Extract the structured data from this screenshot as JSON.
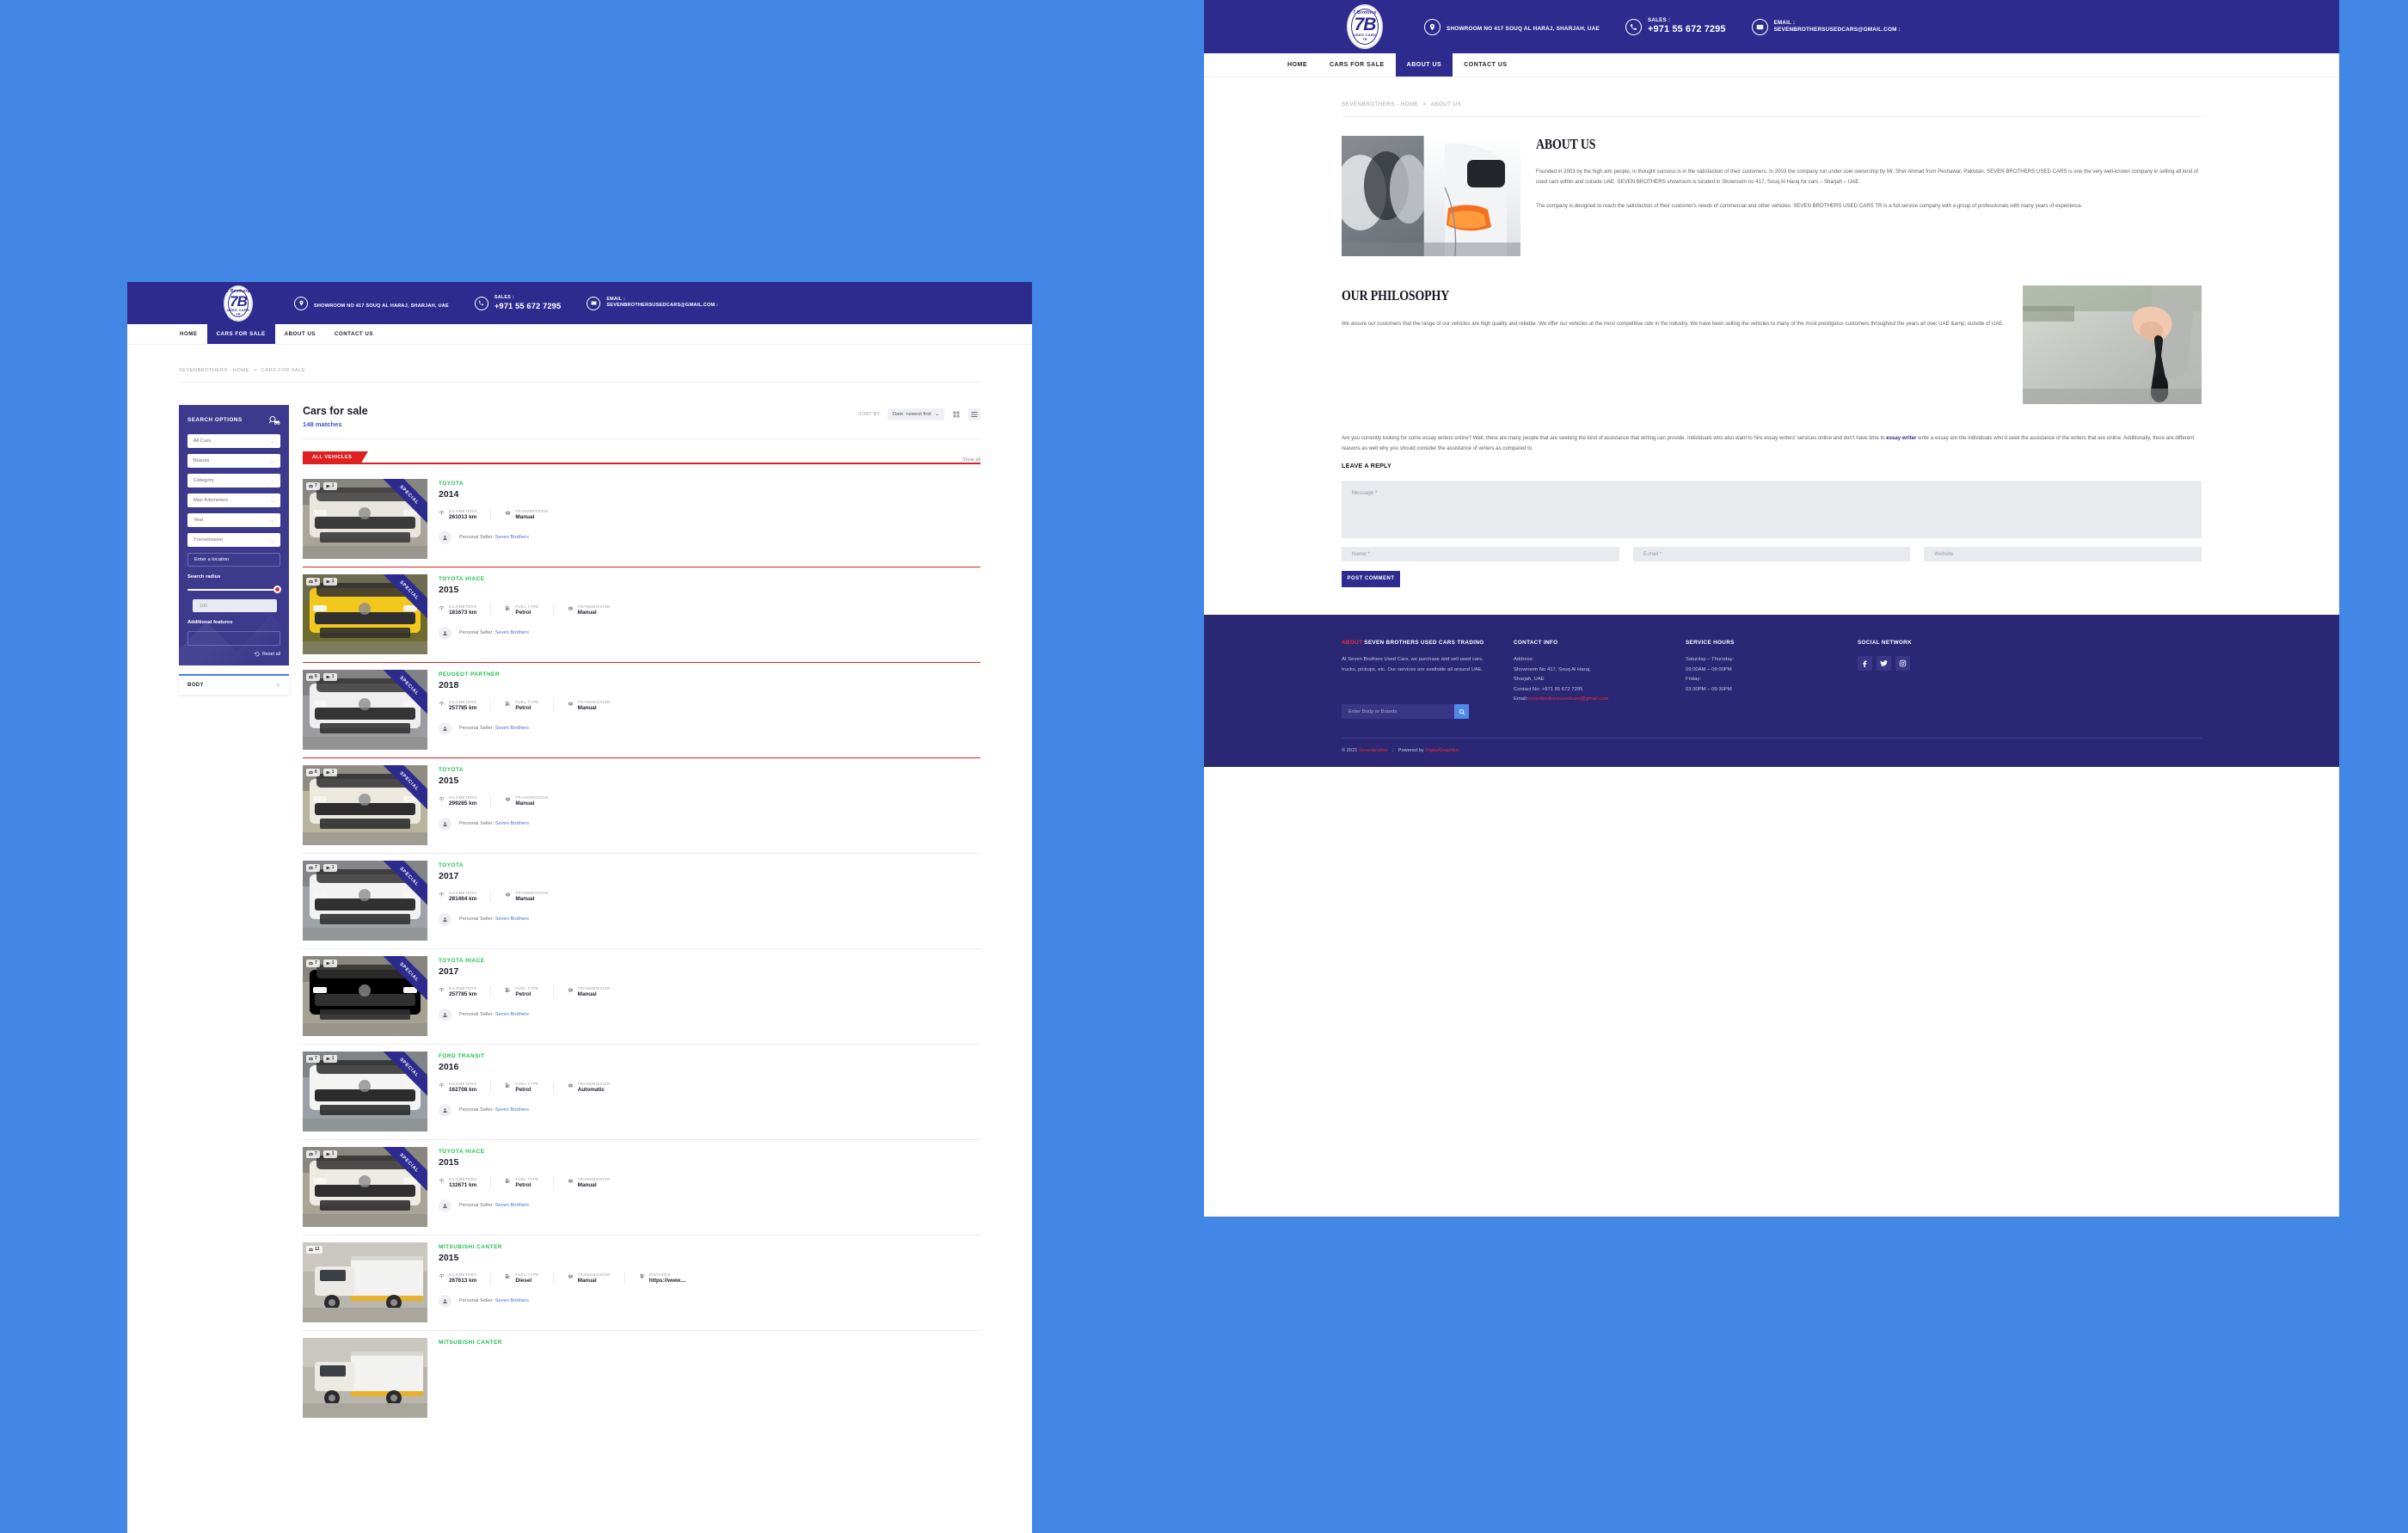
{
  "brand": {
    "logo_top": "7 Brothers",
    "logo_main": "7B",
    "logo_sub": "USED CARS",
    "logo_sub2": "TR"
  },
  "topbar": {
    "location_icon": "map-pin-icon",
    "location_text": "SHOWROOM NO 417 SOUQ AL HARAJ, SHARJAH, UAE",
    "sales_icon": "phone-icon",
    "sales_label": "SALES :",
    "sales_value": "+971 55 672 7295",
    "email_icon": "envelope-icon",
    "email_label": "EMAIL :",
    "email_value": "SEVENBROTHERSUSEDCARS@GMAIL.COM :"
  },
  "nav": {
    "items": [
      {
        "label": "HOME",
        "active_left": false,
        "active_right": false
      },
      {
        "label": "CARS FOR SALE",
        "active_left": true,
        "active_right": false
      },
      {
        "label": "ABOUT US",
        "active_left": false,
        "active_right": true
      },
      {
        "label": "CONTACT US",
        "active_left": false,
        "active_right": false
      }
    ]
  },
  "left_window": {
    "breadcrumb": {
      "root": "SEVENBROTHERS - HOME",
      "sep": ">",
      "current": "CARS FOR SALE"
    },
    "sidebar": {
      "panel_title": "SEARCH OPTIONS",
      "panel_icon": "car-search-icon",
      "selects": [
        {
          "label": "All Cars"
        },
        {
          "label": "Brands"
        },
        {
          "label": "Category"
        },
        {
          "label": "Max Kilometers"
        },
        {
          "label": "Year"
        },
        {
          "label": "Transmission"
        }
      ],
      "location_placeholder": "Enter a location",
      "radius_label": "Search radius",
      "radius_value": "100",
      "additional_features_label": "Additional features",
      "reset_label": "Reset all",
      "reset_icon": "undo-icon",
      "body_panel": {
        "title": "BODY",
        "expand_icon": "plus-icon"
      }
    },
    "results": {
      "title": "Cars for sale",
      "count": "148 matches",
      "sort_label": "SORT BY:",
      "sort_value": "Date: newest first",
      "view_grid_icon": "grid-view-icon",
      "view_list_icon": "list-view-icon",
      "tab_label": "ALL VEHICLES",
      "show_all": "Show all",
      "seller_prefix": "Personal Seller:",
      "seller_name": "Seven Brothers",
      "special_flag": "SPECIAL",
      "spec_keys": {
        "km": "KILOMETERS",
        "fuel": "FUEL TYPE",
        "transmission": "TRANSMISSION",
        "distance": "DISTANCE"
      },
      "listings": [
        {
          "brand": "TOYOTA",
          "year": "2014",
          "photos": "7",
          "videos": "1",
          "special": true,
          "km": "261013 km",
          "fuel": null,
          "transmission": "Manual",
          "distance": null,
          "sep": "red"
        },
        {
          "brand": "TOYOTA HIACE",
          "year": "2015",
          "photos": "8",
          "videos": "1",
          "special": true,
          "km": "181673 km",
          "fuel": "Petrol",
          "transmission": "Manual",
          "distance": null,
          "sep": "red"
        },
        {
          "brand": "PEUGEOT PARTNER",
          "year": "2018",
          "photos": "6",
          "videos": "1",
          "special": true,
          "km": "257785 km",
          "fuel": "Petrol",
          "transmission": "Manual",
          "distance": null,
          "sep": "red"
        },
        {
          "brand": "TOYOTA",
          "year": "2015",
          "photos": "6",
          "videos": "1",
          "special": true,
          "km": "299285 km",
          "fuel": null,
          "transmission": "Manual",
          "distance": null,
          "sep": "plain"
        },
        {
          "brand": "TOYOTA",
          "year": "2017",
          "photos": "7",
          "videos": "1",
          "special": true,
          "km": "281464 km",
          "fuel": null,
          "transmission": "Manual",
          "distance": null,
          "sep": "plain"
        },
        {
          "brand": "TOYOTA HIACE",
          "year": "2017",
          "photos": "7",
          "videos": "1",
          "special": true,
          "km": "257785 km",
          "fuel": "Petrol",
          "transmission": "Manual",
          "distance": null,
          "sep": "plain"
        },
        {
          "brand": "FORD TRANSIT",
          "year": "2016",
          "photos": "7",
          "videos": "1",
          "special": true,
          "km": "162708 km",
          "fuel": "Petrol",
          "transmission": "Automatic",
          "distance": null,
          "sep": "plain"
        },
        {
          "brand": "TOYOTA HIACE",
          "year": "2015",
          "photos": "7",
          "videos": "1",
          "special": true,
          "km": "132671 km",
          "fuel": "Petrol",
          "transmission": "Manual",
          "distance": null,
          "sep": "plain"
        },
        {
          "brand": "MITSUBISHI CANTER",
          "year": "2015",
          "photos": "12",
          "videos": null,
          "special": false,
          "km": "267613 km",
          "fuel": "Diesel",
          "transmission": "Manual",
          "distance": "https://www....",
          "sep": "plain"
        },
        {
          "brand": "MITSUBISHI CANTER",
          "year": "",
          "photos": null,
          "videos": null,
          "special": false,
          "km": null,
          "fuel": null,
          "transmission": null,
          "distance": null,
          "sep": "none"
        }
      ]
    }
  },
  "right_window": {
    "breadcrumb": {
      "root": "SEVENBROTHERS - HOME",
      "sep": ">",
      "current": "ABOUT US"
    },
    "about": {
      "title": "ABOUT US",
      "photo_alt": "showroom-cars-photo",
      "paragraph1": "Founded in 2003 by the high aim people, in thought success is in the satisfaction of their customers. In 2003 the company run under sole ownership by Mr. Sher Ahmad from Peshawar, Pakistan. SEVEN BROTHERS USED CARS is one the very well-known company in selling all kind of used cars within and outside UAE. SEVEN BROTHERS showroom is located in Showroom no 417, Souq Al Haraj for cars – Sharjah – UAE.",
      "paragraph2": "The company is designed to reach the satisfaction of their customer's needs of commercial and other vehicles. SEVEN BROTHERS USED CARS TR is a full service company with a group of professionals with many years of experience."
    },
    "philosophy": {
      "title": "OUR PHILOSOPHY",
      "photo_alt": "car-keys-photo",
      "paragraph": "We assure our customers that the range of our vehicles are high quality and reliable. We offer our vehicles at the most competitive rate in the industry. We have been selling the vehicles to many of the most prestigious customers throughout the years all over UAE &amp; outside of UAE."
    },
    "essay": {
      "before_link": "Are you currently looking for some essay writers online? Well, there are many people that are seeking the kind of assistance that writing can provide. Individuals who also want to hire essay writers' services online and don't have time to ",
      "link_text": "essay writer",
      "after_link": " write a essay are the individuals who'd seek the assistance of the writers that are online. Additionally, there are different reasons as well why you should consider the assistance of writers as compared to."
    },
    "reply": {
      "heading": "LEAVE A REPLY",
      "message_placeholder": "Message *",
      "name_placeholder": "Name *",
      "email_placeholder": "E-mail *",
      "website_placeholder": "Website",
      "submit_label": "POST COMMENT"
    }
  },
  "footer": {
    "about": {
      "heading_hl": "ABOUT",
      "heading_rest": " SEVEN BROTHERS USED CARS TRADING",
      "text": "At Seven Brothers Used Cars, we purchase and sell used cars, trucks, pickups, etc. Our services are available all around UAE."
    },
    "contact": {
      "heading": "CONTACT INFO",
      "address_label": "Address:",
      "address_line1": "Showroom No 417, Souq Al Haraj,",
      "address_line2": "Sharjah, UAE",
      "phone_line": "Contact No: +971 55 672 7295",
      "email_label": "Email:",
      "email_value": "sevenbrothersusedcars@gmail.com"
    },
    "hours": {
      "heading": "SERVICE HOURS",
      "range1_label": "Saturday – Thursday:",
      "range1_value": "09:00AM – 09:00PM",
      "range2_label": "Friday:",
      "range2_value": "03:30PM – 09:30PM"
    },
    "social": {
      "heading": "SOCIAL NETWORK",
      "items": [
        {
          "name": "facebook-icon",
          "glyph": "f"
        },
        {
          "name": "twitter-icon",
          "glyph": "t"
        },
        {
          "name": "instagram-icon",
          "glyph": "i"
        }
      ]
    },
    "search": {
      "placeholder": "Enter Body or Brands",
      "button_icon": "search-icon"
    },
    "copyright": {
      "prefix": "© 2021 ",
      "brand": "Sevenbrother",
      "sep": "|",
      "powered": "Powered by ",
      "agency": "DigitalGraphiks"
    }
  },
  "colors": {
    "page_background": "#4287e5",
    "brand_dark_blue": "#2e2b8f",
    "footer_blue": "#2a2774",
    "accent_red": "#e02020",
    "accent_green": "#1fc04f",
    "link_blue": "#3a56d4"
  }
}
